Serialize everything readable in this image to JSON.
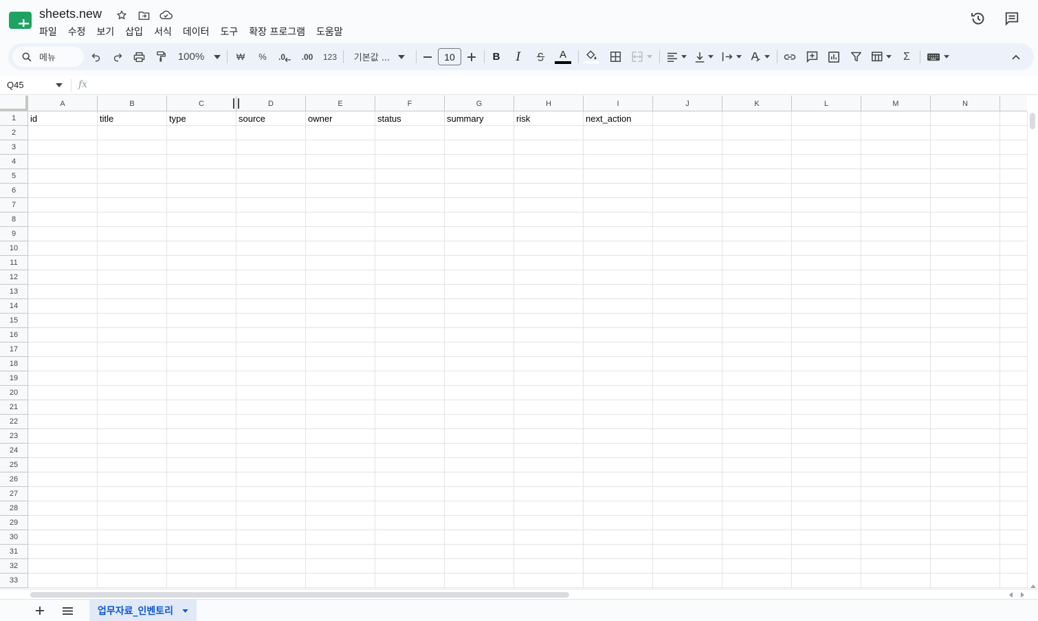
{
  "app": {
    "title": "sheets.new",
    "menu": [
      "파일",
      "수정",
      "보기",
      "삽입",
      "서식",
      "데이터",
      "도구",
      "확장 프로그램",
      "도움말"
    ]
  },
  "toolbar": {
    "search_label": "메뉴",
    "zoom": "100%",
    "currency_symbol": "₩",
    "percent_symbol": "%",
    "decrease_decimal": ".0",
    "increase_decimal": ".00",
    "number_format": "123",
    "font": "기본값 ...",
    "font_size": "10",
    "bold": "B",
    "italic": "I",
    "text_color_label": "A",
    "sum_symbol": "Σ"
  },
  "formula_bar": {
    "name_box": "Q45",
    "fx_label": "fx"
  },
  "grid": {
    "columns": [
      "A",
      "B",
      "C",
      "D",
      "E",
      "F",
      "G",
      "H",
      "I",
      "J",
      "K",
      "L",
      "M",
      "N"
    ],
    "rows": [
      "1",
      "2",
      "3",
      "4",
      "5",
      "6",
      "7",
      "8",
      "9",
      "10",
      "11",
      "12",
      "13",
      "14",
      "15",
      "16",
      "17",
      "18",
      "19",
      "20",
      "21",
      "22",
      "23",
      "24",
      "25",
      "26",
      "27",
      "28",
      "29",
      "30",
      "31",
      "32",
      "33"
    ],
    "header_values": [
      "id",
      "title",
      "type",
      "source",
      "owner",
      "status",
      "summary",
      "risk",
      "next_action",
      "",
      "",
      "",
      "",
      ""
    ]
  },
  "sheets": {
    "active": "업무자료_인벤토리"
  },
  "colors": {
    "accent": "#0b57d0",
    "toolbar_bg": "#edf2fa",
    "active_tab_bg": "#e1e9f7",
    "logo_green": "#0f9d58"
  }
}
